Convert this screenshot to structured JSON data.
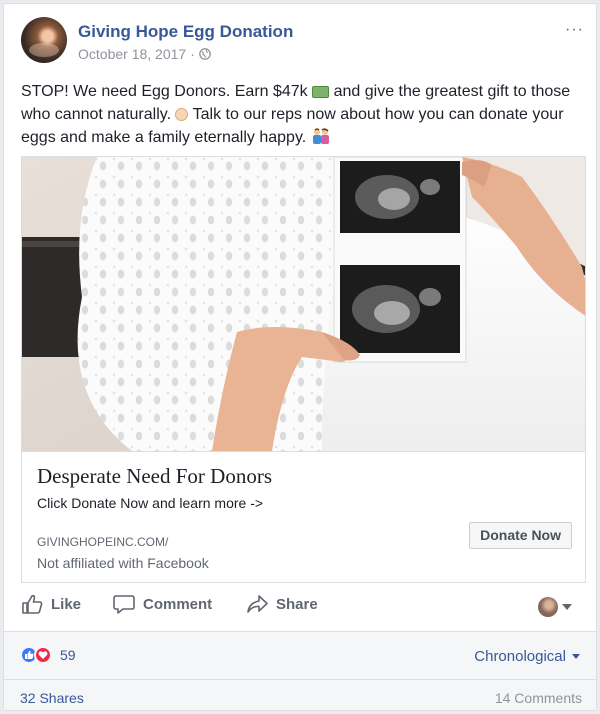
{
  "post": {
    "page_name": "Giving Hope Egg Donation",
    "date": "October 18, 2017",
    "separator": "·",
    "privacy_icon": "globe-icon",
    "more_label": "···",
    "text_part1": "STOP! We need Egg Donors. Earn $47k",
    "text_part2": "and give the greatest gift to those who cannot naturally.",
    "text_part3": "Talk to our reps now about how you can donate your eggs and make a family eternally happy.",
    "emoji": [
      "money-icon",
      "baby-icon",
      "family-icon"
    ]
  },
  "link_preview": {
    "title": "Desperate Need For Donors",
    "description": "Click Donate Now and learn more ->",
    "domain": "GIVINGHOPEINC.COM/",
    "disclaimer": "Not affiliated with Facebook",
    "button_label": "Donate Now",
    "image_description_icon": "ultrasound-photo"
  },
  "actions": {
    "like": "Like",
    "comment": "Comment",
    "share": "Share"
  },
  "footer": {
    "reaction_count": "59",
    "sort_label": "Chronological",
    "shares": "32 Shares",
    "comments": "14 Comments"
  },
  "colors": {
    "link_blue": "#385898",
    "like_blue": "#3b7cff",
    "love_red": "#f0284a",
    "action_gray": "#606770"
  }
}
